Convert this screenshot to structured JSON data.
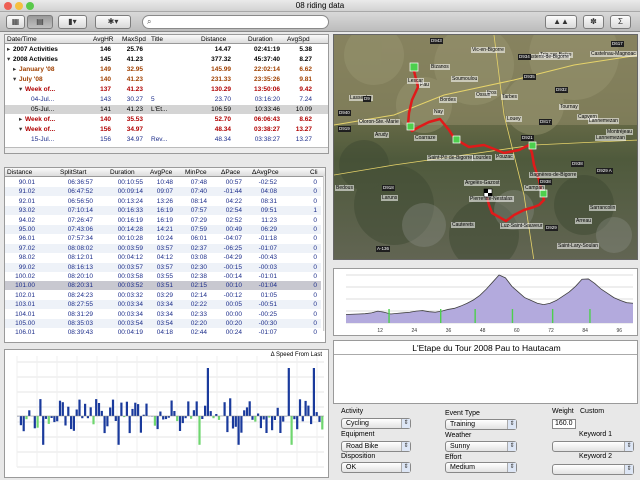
{
  "window": {
    "title": "08 riding data"
  },
  "toolbar": {
    "search_placeholder": "",
    "search_glyph": "⌕"
  },
  "activities": {
    "columns": [
      "Date/Time",
      "AvgHR",
      "MaxSpd",
      "Title",
      "Distance",
      "Duration",
      "AvgSpd"
    ],
    "rows": [
      {
        "name": "2007 Activities",
        "hr": "146",
        "max": "25.76",
        "title": "",
        "dist": "14.47",
        "dur": "02:41:19",
        "avg": "5.38",
        "color": "#000000",
        "bold": true,
        "tri": "▸",
        "ind": 0,
        "bg": ""
      },
      {
        "name": "2008 Activities",
        "hr": "145",
        "max": "41.23",
        "title": "",
        "dist": "377.32",
        "dur": "45:37:40",
        "avg": "8.27",
        "color": "#000000",
        "bold": true,
        "tri": "▾",
        "ind": 0,
        "bg": ""
      },
      {
        "name": "January '08",
        "hr": "149",
        "max": "32.95",
        "title": "",
        "dist": "145.99",
        "dur": "22:02:14",
        "avg": "6.62",
        "color": "#a04000",
        "bold": true,
        "tri": "▸",
        "ind": 1,
        "bg": ""
      },
      {
        "name": "July '08",
        "hr": "140",
        "max": "41.23",
        "title": "",
        "dist": "231.33",
        "dur": "23:35:26",
        "avg": "9.81",
        "color": "#a04000",
        "bold": true,
        "tri": "▾",
        "ind": 1,
        "bg": ""
      },
      {
        "name": "Week of...",
        "hr": "137",
        "max": "41.23",
        "title": "",
        "dist": "130.29",
        "dur": "13:50:06",
        "avg": "9.42",
        "color": "#b00000",
        "bold": true,
        "tri": "▾",
        "ind": 2,
        "bg": ""
      },
      {
        "name": "04-Jul...",
        "hr": "143",
        "max": "30.27",
        "title": "5",
        "dist": "23.70",
        "dur": "03:16:20",
        "avg": "7.24",
        "color": "#1c2d8a",
        "bold": false,
        "tri": "",
        "ind": 3,
        "bg": ""
      },
      {
        "name": "05-Jul...",
        "hr": "141",
        "max": "41.23",
        "title": "L'Et...",
        "dist": "106.59",
        "dur": "10:33:46",
        "avg": "10.09",
        "color": "#000000",
        "bold": false,
        "tri": "",
        "ind": 3,
        "bg": "#d4d4d4"
      },
      {
        "name": "Week of...",
        "hr": "140",
        "max": "35.53",
        "title": "",
        "dist": "52.70",
        "dur": "06:06:43",
        "avg": "8.62",
        "color": "#b00000",
        "bold": true,
        "tri": "▸",
        "ind": 2,
        "bg": ""
      },
      {
        "name": "Week of...",
        "hr": "156",
        "max": "34.97",
        "title": "",
        "dist": "48.34",
        "dur": "03:38:27",
        "avg": "13.27",
        "color": "#b00000",
        "bold": true,
        "tri": "▾",
        "ind": 2,
        "bg": ""
      },
      {
        "name": "15-Jul...",
        "hr": "156",
        "max": "34.97",
        "title": "Rev...",
        "dist": "48.34",
        "dur": "03:38:27",
        "avg": "13.27",
        "color": "#1c2d8a",
        "bold": false,
        "tri": "",
        "ind": 3,
        "bg": ""
      }
    ]
  },
  "splits": {
    "columns": [
      "Distance",
      "SplitStart",
      "Duration",
      "AvgPce",
      "MinPce",
      "ΔPace",
      "ΔAvgPce",
      "Cli"
    ],
    "rows": [
      [
        "90.01",
        "06:36:57",
        "00:10:55",
        "10:48",
        "07:48",
        "00:57",
        "-02:52",
        "0"
      ],
      [
        "91.02",
        "06:47:52",
        "00:09:14",
        "09:07",
        "07:40",
        "-01:44",
        "04:08",
        "0"
      ],
      [
        "92.01",
        "06:56:50",
        "00:13:24",
        "13:26",
        "08:14",
        "04:22",
        "08:31",
        "0"
      ],
      [
        "93.02",
        "07:10:14",
        "00:16:33",
        "16:19",
        "07:57",
        "02:54",
        "09:51",
        "1"
      ],
      [
        "94.02",
        "07:26:47",
        "00:16:19",
        "16:19",
        "07:29",
        "02:52",
        "11:23",
        "0"
      ],
      [
        "95.00",
        "07:43:06",
        "00:14:28",
        "14:21",
        "07:59",
        "00:49",
        "06:29",
        "0"
      ],
      [
        "96.01",
        "07:57:34",
        "00:10:28",
        "10:24",
        "06:01",
        "-04:07",
        "-01:18",
        "0"
      ],
      [
        "97.02",
        "08:08:02",
        "00:03:59",
        "03:57",
        "02:37",
        "-06:25",
        "-01:07",
        "0"
      ],
      [
        "98.02",
        "08:12:01",
        "00:04:12",
        "04:12",
        "03:08",
        "-04:29",
        "-00:43",
        "0"
      ],
      [
        "99.02",
        "08:16:13",
        "00:03:57",
        "03:57",
        "02:30",
        "-00:15",
        "-00:03",
        "0"
      ],
      [
        "100.02",
        "08:20:10",
        "00:03:58",
        "03:55",
        "02:38",
        "-00:14",
        "-01:01",
        "0"
      ],
      [
        "101.00",
        "08:20:31",
        "00:03:52",
        "03:51",
        "02:15",
        "00:10",
        "-01:04",
        "0"
      ],
      [
        "102.01",
        "08:24:23",
        "00:03:32",
        "03:29",
        "02:14",
        "-00:12",
        "01:05",
        "0"
      ],
      [
        "103.01",
        "08:27:55",
        "00:03:34",
        "03:34",
        "02:22",
        "00:05",
        "-00:51",
        "0"
      ],
      [
        "104.01",
        "08:31:29",
        "00:03:34",
        "03:34",
        "02:33",
        "00:00",
        "-00:25",
        "0"
      ],
      [
        "105.00",
        "08:35:03",
        "00:03:54",
        "03:54",
        "02:20",
        "00:20",
        "-00:30",
        "0"
      ],
      [
        "106.01",
        "08:39:43",
        "00:04:19",
        "04:18",
        "02:44",
        "00:24",
        "-01:07",
        "0"
      ]
    ],
    "selected_row": 11
  },
  "bar_chart": {
    "label": "Δ Speed From Last"
  },
  "map": {
    "places": [
      {
        "t": "Pau",
        "x": 85,
        "y": 47
      },
      {
        "t": "Bizanos",
        "x": 96,
        "y": 29
      },
      {
        "t": "Lescar",
        "x": 73,
        "y": 43
      },
      {
        "t": "Oloron-Ste.-Marie",
        "x": 24,
        "y": 84
      },
      {
        "t": "Nay",
        "x": 99,
        "y": 74
      },
      {
        "t": "Bordes",
        "x": 105,
        "y": 62
      },
      {
        "t": "Ibos",
        "x": 152,
        "y": 55
      },
      {
        "t": "Tarbes",
        "x": 167,
        "y": 59
      },
      {
        "t": "Lourdes",
        "x": 138,
        "y": 120
      },
      {
        "t": "Bagnères-de-Bigorre",
        "x": 195,
        "y": 137
      },
      {
        "t": "Argelès-Gazost",
        "x": 130,
        "y": 145
      },
      {
        "t": "Cauterets",
        "x": 117,
        "y": 187
      },
      {
        "t": "Pierrefitte-Nestalas",
        "x": 135,
        "y": 161
      },
      {
        "t": "Luz-Saint-Sauveur",
        "x": 166,
        "y": 188
      },
      {
        "t": "Arudy",
        "x": 40,
        "y": 97
      },
      {
        "t": "Saint-Pé-de-Bigorre",
        "x": 93,
        "y": 120
      },
      {
        "t": "Coarraze",
        "x": 80,
        "y": 100
      },
      {
        "t": "Lannemezan",
        "x": 261,
        "y": 100
      },
      {
        "t": "Montréjeau",
        "x": 272,
        "y": 94
      },
      {
        "t": "Castelnau-Magnoac",
        "x": 256,
        "y": 16
      },
      {
        "t": "Trie-sur-Baïse",
        "x": 205,
        "y": 17
      },
      {
        "t": "Rabastens-de-Bigorre",
        "x": 185,
        "y": 19
      },
      {
        "t": "Vic-en-Bigorre",
        "x": 137,
        "y": 12
      },
      {
        "t": "Saint-Lary-Soulan",
        "x": 223,
        "y": 208
      },
      {
        "t": "Tournay",
        "x": 225,
        "y": 69
      },
      {
        "t": "Campan",
        "x": 190,
        "y": 150
      },
      {
        "t": "Capvern",
        "x": 243,
        "y": 79
      },
      {
        "t": "Arreau",
        "x": 241,
        "y": 183
      },
      {
        "t": "Lannemezan",
        "x": 254,
        "y": 83
      },
      {
        "t": "Bagnères-de-Luchon",
        "x": 261,
        "y": 226
      },
      {
        "t": "Soumoulou",
        "x": 117,
        "y": 41
      },
      {
        "t": "Ossun",
        "x": 141,
        "y": 57
      },
      {
        "t": "Louey",
        "x": 172,
        "y": 81
      },
      {
        "t": "Pouzac",
        "x": 161,
        "y": 119
      },
      {
        "t": "Sarrancolin",
        "x": 255,
        "y": 170
      },
      {
        "t": "Lasseube",
        "x": 15,
        "y": 60
      },
      {
        "t": "Laruns",
        "x": 47,
        "y": 160
      },
      {
        "t": "Bedous",
        "x": 1,
        "y": 150
      }
    ],
    "roads": [
      {
        "t": "D943",
        "x": 96,
        "y": 3
      },
      {
        "t": "D934",
        "x": 184,
        "y": 19
      },
      {
        "t": "D932",
        "x": 221,
        "y": 52
      },
      {
        "t": "D935",
        "x": 189,
        "y": 39
      },
      {
        "t": "D940",
        "x": 4,
        "y": 75
      },
      {
        "t": "D919",
        "x": 4,
        "y": 91
      },
      {
        "t": "D9",
        "x": 29,
        "y": 61
      },
      {
        "t": "D817",
        "x": 205,
        "y": 84
      },
      {
        "t": "D921",
        "x": 187,
        "y": 100
      },
      {
        "t": "D929 A",
        "x": 262,
        "y": 133
      },
      {
        "t": "D929",
        "x": 211,
        "y": 190
      },
      {
        "t": "D938",
        "x": 205,
        "y": 144
      },
      {
        "t": "A-136",
        "x": 42,
        "y": 211
      },
      {
        "t": "D918",
        "x": 48,
        "y": 150
      },
      {
        "t": "D617",
        "x": 277,
        "y": 6
      },
      {
        "t": "D938",
        "x": 237,
        "y": 126
      }
    ]
  },
  "elevation": {
    "x_ticks": [
      "12",
      "24",
      "36",
      "48",
      "60",
      "72",
      "84",
      "96"
    ],
    "profile": [
      300,
      310,
      320,
      330,
      360,
      420,
      380,
      320,
      340,
      360,
      380,
      420,
      440,
      400,
      380,
      420,
      480,
      520,
      600,
      700,
      820,
      980,
      1200,
      1450,
      1700,
      1600,
      1300,
      1100,
      900,
      800,
      700,
      650,
      700,
      800,
      950,
      1100,
      1300,
      1550,
      1560,
      1400,
      1200,
      1050,
      900,
      800,
      720,
      700
    ]
  },
  "notes": {
    "title": "L'Etape du Tour 2008 Pau to Hautacam"
  },
  "properties": {
    "activity": {
      "label": "Activity",
      "value": "Cycling"
    },
    "equipment": {
      "label": "Equipment",
      "value": "Road Bike"
    },
    "disposition": {
      "label": "Disposition",
      "value": "OK"
    },
    "event_type": {
      "label": "Event Type",
      "value": "Training"
    },
    "weather": {
      "label": "Weather",
      "value": "Sunny"
    },
    "effort": {
      "label": "Effort",
      "value": "Medium"
    },
    "weight": {
      "label": "Weight",
      "value": "160.0"
    },
    "custom": {
      "label": "Custom"
    },
    "keyword1": {
      "label": "Keyword 1",
      "value": ""
    },
    "keyword2": {
      "label": "Keyword 2",
      "value": ""
    }
  },
  "colors": {
    "bar": "#1a3a9c",
    "bar_neg_green": "#6fd66f",
    "route": "#e01a1a",
    "profile_fill": "#b3aadd",
    "profile_line": "#404040"
  }
}
